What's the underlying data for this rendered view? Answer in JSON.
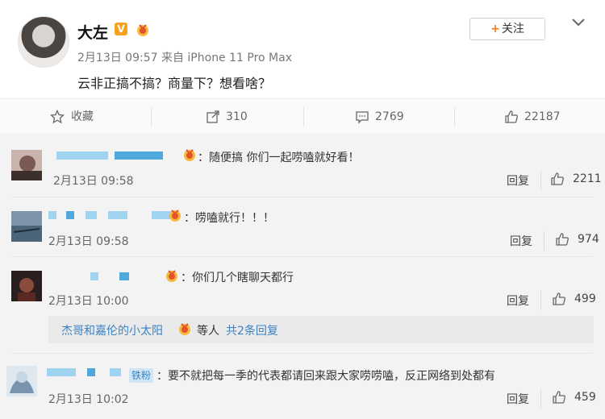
{
  "post": {
    "author": "大左",
    "verified_badge": "V",
    "timestamp": "2月13日 09:57 来自 iPhone 11 Pro Max",
    "text": "云非正搞不搞？商量下？想看啥？",
    "follow_label": "关注",
    "follow_plus": "+",
    "accent_color": "#f07a1a"
  },
  "actions": {
    "favorite_label": "收藏",
    "repost_count": "310",
    "comment_count": "2769",
    "like_count": "22187"
  },
  "comments": [
    {
      "text": "：随便搞 你们一起唠嗑就好看！",
      "time": "2月13日 09:58",
      "reply": "回复",
      "likes": "2211"
    },
    {
      "text": "：唠嗑就行！！！",
      "time": "2月13日 09:58",
      "reply": "回复",
      "likes": "974"
    },
    {
      "text": "：你们几个瞎聊天都行",
      "time": "2月13日 10:00",
      "reply": "回复",
      "likes": "499"
    },
    {
      "text": "：要不就把每一季的代表都请回来跟大家唠唠嗑，反正网络到处都有",
      "time": "2月13日 10:02",
      "reply": "回复",
      "likes": "459",
      "fan_badge": "铁粉"
    }
  ],
  "sub_replies": {
    "name": "杰哥和嘉伦的小太阳",
    "suffix": "等人",
    "link": "共2条回复"
  },
  "icons": [
    "star-icon",
    "repost-icon",
    "comment-icon",
    "thumbs-up-icon",
    "chevron-down-icon",
    "medal-icon"
  ]
}
